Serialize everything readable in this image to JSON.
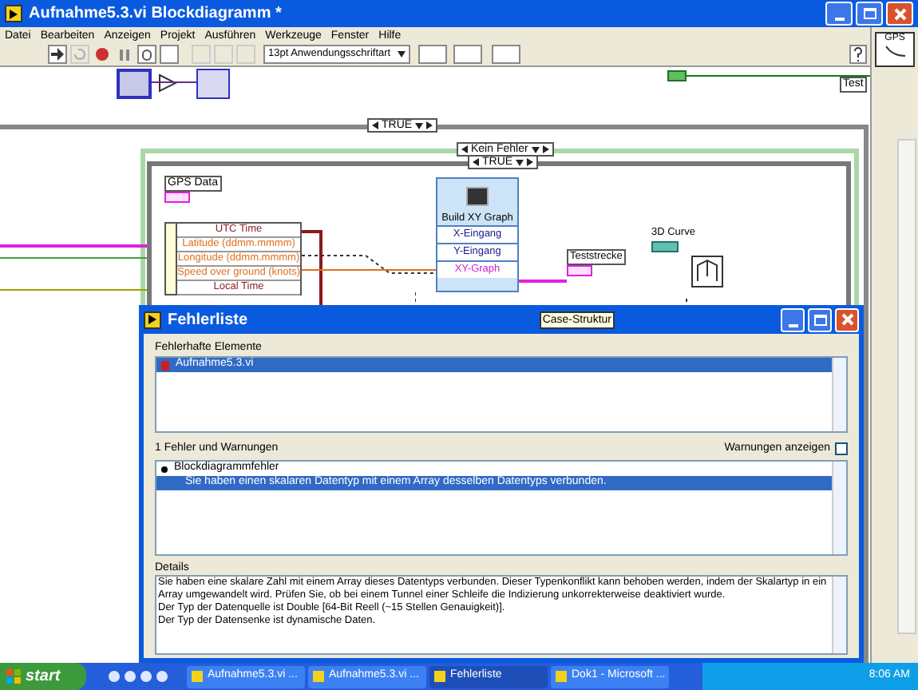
{
  "window": {
    "title": "Aufnahme5.3.vi Blockdiagramm *"
  },
  "menu": [
    "Datei",
    "Bearbeiten",
    "Anzeigen",
    "Projekt",
    "Ausführen",
    "Werkzeuge",
    "Fenster",
    "Hilfe"
  ],
  "toolbar": {
    "font": "13pt Anwendungsschriftart"
  },
  "diagram": {
    "selectors": [
      "TRUE",
      "Kein Fehler",
      "TRUE"
    ],
    "gps_label": "GPS Data",
    "cluster": [
      {
        "label": "UTC Time",
        "color": "#8b1a1a"
      },
      {
        "label": "Latitude (ddmm.mmmm)",
        "color": "#e07020"
      },
      {
        "label": "Longitude (ddmm.mmmm)",
        "color": "#e07020"
      },
      {
        "label": "Speed over ground (knots)",
        "color": "#e07020"
      },
      {
        "label": "Local Time",
        "color": "#8b1a1a"
      }
    ],
    "build_xy": {
      "title": "Build XY Graph",
      "terminals": [
        {
          "label": "X-Eingang",
          "color": "#1a1a8b"
        },
        {
          "label": "Y-Eingang",
          "color": "#1a1a8b"
        },
        {
          "label": "XY-Graph",
          "color": "#d020d0"
        }
      ]
    },
    "output_label": "Teststrecke",
    "curve_label": "3D Curve",
    "edge_label": "Test",
    "palette_label": "GPS"
  },
  "tooltip": "Case-Struktur",
  "dialog": {
    "title": "Fehlerliste",
    "elements_label": "Fehlerhafte Elemente",
    "elements": [
      {
        "label": "Aufnahme5.3.vi",
        "selected": true
      }
    ],
    "count": "1 Fehler und Warnungen",
    "show_warnings": {
      "label": "Warnungen anzeigen",
      "checked": false
    },
    "errors": [
      {
        "label": "Blockdiagrammfehler",
        "expanded": true,
        "children": [
          {
            "label": "Sie haben einen skalaren Datentyp mit einem Array desselben Datentyps verbunden.",
            "selected": true
          }
        ]
      }
    ],
    "details_label": "Details",
    "details": [
      "Sie haben eine skalare Zahl mit einem Array dieses Datentyps verbunden. Dieser Typenkonflikt kann behoben werden, indem der Skalartyp in ein Array umgewandelt wird. Prüfen Sie, ob bei einem Tunnel einer Schleife die Indizierung unkorrekterweise deaktiviert wurde.",
      "Der Typ der Datenquelle ist Double [64-Bit Reell (~15 Stellen Genauigkeit)].",
      "Der Typ der Datensenke ist dynamische Daten."
    ]
  },
  "taskbar": {
    "start": "start",
    "tasks": [
      {
        "label": "Aufnahme5.3.vi ...",
        "selected": false
      },
      {
        "label": "Aufnahme5.3.vi ...",
        "selected": false
      },
      {
        "label": "Fehlerliste",
        "selected": true
      },
      {
        "label": "Dok1 - Microsoft ...",
        "selected": false
      }
    ],
    "clock": "8:06 AM"
  }
}
